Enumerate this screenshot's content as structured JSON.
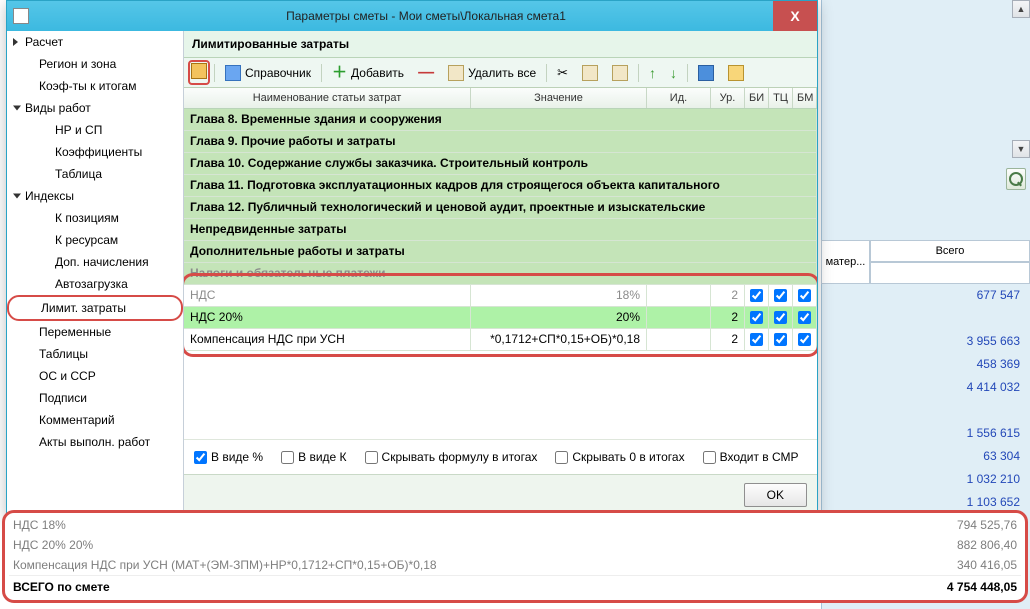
{
  "dialog": {
    "title": "Параметры сметы - Мои сметы\\Локальная смета1",
    "close": "X",
    "panel_title": "Лимитированные затраты",
    "toolbar": {
      "ref": "Справочник",
      "add": "Добавить",
      "delall": "Удалить все"
    },
    "grid": {
      "hdr": {
        "name": "Наименование статьи затрат",
        "val": "Значение",
        "id": "Ид.",
        "ur": "Ур.",
        "bi": "БИ",
        "tc": "ТЦ",
        "bm": "БМ"
      },
      "chapters": [
        "Глава 8. Временные здания и сооружения",
        "Глава 9. Прочие работы и затраты",
        "Глава 10. Содержание службы заказчика. Строительный контроль",
        "Глава 11. Подготовка эксплуатационных кадров для строящегося объекта капитального",
        "Глава 12. Публичный технологический и ценовой аудит, проектные и изыскательские",
        "Непредвиденные затраты",
        "Дополнительные работы и затраты",
        "Налоги и обязательные платежи"
      ],
      "rows": [
        {
          "name": "НДС",
          "val": "18%",
          "ur": "2"
        },
        {
          "name": "НДС 20%",
          "val": "20%",
          "ur": "2"
        },
        {
          "name": "Компенсация НДС при УСН",
          "val": "*0,1712+СП*0,15+ОБ)*0,18",
          "ur": "2"
        }
      ]
    },
    "opts": {
      "pct": "В виде %",
      "k": "В виде К",
      "hidef": "Скрывать формулу в итогах",
      "hide0": "Скрывать 0 в итогах",
      "smr": "Входит в СМР"
    },
    "ok": "OK"
  },
  "tree": [
    {
      "t": "Расчет",
      "lvl": 0,
      "p": 1,
      "closed": 1
    },
    {
      "t": "Регион и зона",
      "lvl": 1
    },
    {
      "t": "Коэф-ты к итогам",
      "lvl": 1,
      "dots": 1
    },
    {
      "t": "Виды работ",
      "lvl": 0,
      "p": 1
    },
    {
      "t": "НР и СП",
      "lvl": 2
    },
    {
      "t": "Коэффициенты",
      "lvl": 2,
      "dots": 1
    },
    {
      "t": "Таблица",
      "lvl": 2
    },
    {
      "t": "Индексы",
      "lvl": 0,
      "p": 1
    },
    {
      "t": "К позициям",
      "lvl": 2,
      "dots": 1
    },
    {
      "t": "К ресурсам",
      "lvl": 2,
      "dots": 1
    },
    {
      "t": "Доп. начисления",
      "lvl": 2
    },
    {
      "t": "Автозагрузка",
      "lvl": 2,
      "dots": 1
    },
    {
      "t": "Лимит. затраты",
      "lvl": 1,
      "sel": 1,
      "dots": 1
    },
    {
      "t": "Переменные",
      "lvl": 1,
      "dots": 1
    },
    {
      "t": "Таблицы",
      "lvl": 1,
      "dots": 1
    },
    {
      "t": "ОС и ССР",
      "lvl": 1,
      "dots": 1
    },
    {
      "t": "Подписи",
      "lvl": 1,
      "dots": 1
    },
    {
      "t": "Комментарий",
      "lvl": 1,
      "dots": 1
    },
    {
      "t": "Акты выполн. работ",
      "lvl": 1,
      "dots": 1
    }
  ],
  "bg": {
    "hdr_all": "Всего",
    "hdr_mat": "матер...",
    "rows": [
      "677 547",
      "",
      "3 955 663",
      "458 369",
      "4 414 032",
      "",
      "1 556 615",
      "63 304",
      "1 032 210",
      "1 103 652"
    ]
  },
  "summary": {
    "rows": [
      {
        "l": "НДС 18%",
        "r": "794 525,76"
      },
      {
        "l": "НДС 20% 20%",
        "r": "882 806,40"
      },
      {
        "l": "Компенсация НДС при УСН (МАТ+(ЭМ-ЗПМ)+НР*0,1712+СП*0,15+ОБ)*0,18",
        "r": "340 416,05"
      }
    ],
    "total": {
      "l": "ВСЕГО по смете",
      "r": "4 754 448,05"
    }
  }
}
